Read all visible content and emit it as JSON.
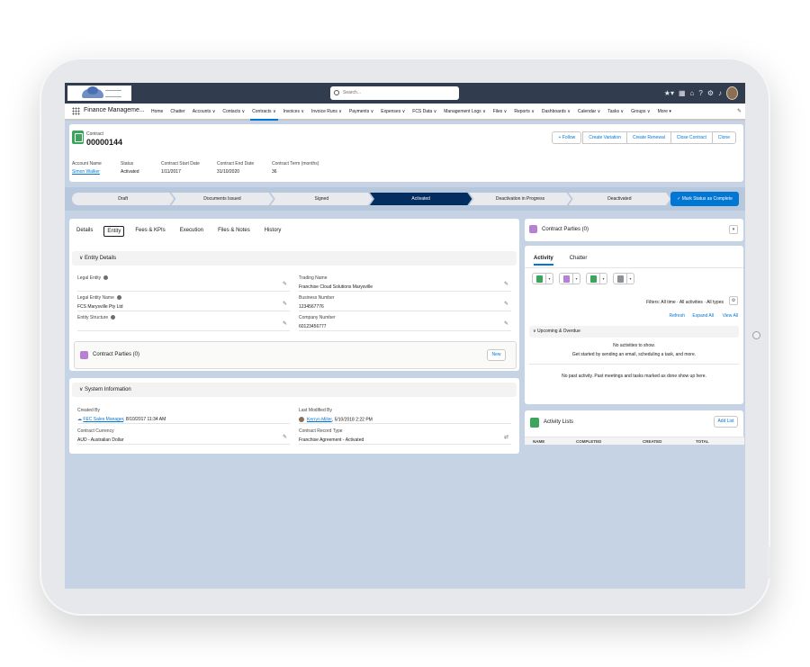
{
  "header": {
    "search_placeholder": "Search..."
  },
  "nav": {
    "app_name": "Finance Manageme...",
    "items": [
      {
        "label": "Home"
      },
      {
        "label": "Chatter"
      },
      {
        "label": "Accounts ∨"
      },
      {
        "label": "Contacts ∨"
      },
      {
        "label": "Contracts ∨"
      },
      {
        "label": "Invoices ∨"
      },
      {
        "label": "Invoice Runs ∨"
      },
      {
        "label": "Payments ∨"
      },
      {
        "label": "Expenses ∨"
      },
      {
        "label": "FCS Data ∨"
      },
      {
        "label": "Management Logs ∨"
      },
      {
        "label": "Files ∨"
      },
      {
        "label": "Reports ∨"
      },
      {
        "label": "Dashboards ∨"
      },
      {
        "label": "Calendar ∨"
      },
      {
        "label": "Tasks ∨"
      },
      {
        "label": "Groups ∨"
      },
      {
        "label": "More ▾"
      }
    ]
  },
  "record": {
    "type": "Contract",
    "number": "00000144",
    "buttons": {
      "follow": "+ Follow",
      "variation": "Create Variation",
      "renewal": "Create Renewal",
      "close": "Close Contract",
      "clone": "Clone"
    },
    "fields": [
      {
        "label": "Account Name",
        "value": "Simon Walker"
      },
      {
        "label": "Status",
        "value": "Activated"
      },
      {
        "label": "Contract Start Date",
        "value": "1/11/2017"
      },
      {
        "label": "Contract End Date",
        "value": "31/10/2020"
      },
      {
        "label": "Contract Term (months)",
        "value": "36"
      }
    ]
  },
  "path": {
    "stages": [
      {
        "label": "Draft"
      },
      {
        "label": "Documents Issued"
      },
      {
        "label": "Signed"
      },
      {
        "label": "Activated"
      },
      {
        "label": "Deactivation in Progress"
      },
      {
        "label": "Deactivated"
      }
    ],
    "mark_button": "✓ Mark Status as Complete"
  },
  "tabs": [
    {
      "label": "Details"
    },
    {
      "label": "Entity"
    },
    {
      "label": "Fees & KPIs"
    },
    {
      "label": "Execution"
    },
    {
      "label": "Files & Notes"
    },
    {
      "label": "History"
    }
  ],
  "entity": {
    "section_title": "∨  Entity Details",
    "legal_entity_label": "Legal Entity",
    "legal_entity_value": "",
    "trading_name_label": "Trading Name",
    "trading_name_value": "Franchise Cloud Solutions Marysville",
    "legal_entity_name_label": "Legal Entity Name",
    "legal_entity_name_value": "FCS Marysville Pty Ltd",
    "business_number_label": "Business Number",
    "business_number_value": "1234567776",
    "entity_structure_label": "Entity Structure",
    "entity_structure_value": "",
    "company_number_label": "Company Number",
    "company_number_value": "60123456777",
    "contract_parties_title": "Contract Parties (0)",
    "new_button": "New"
  },
  "system": {
    "section_title": "∨  System Information",
    "created_by_label": "Created By",
    "created_by_user": "FEC Sales Manager",
    "created_by_date": ", 8/10/2017 11:34 AM",
    "last_modified_label": "Last Modified By",
    "last_modified_user": "Kerryn Miller",
    "last_modified_date": ", 5/10/2018 2:22 PM",
    "currency_label": "Contract Currency",
    "currency_value": "AUD - Australian Dollar",
    "record_type_label": "Contract Record Type",
    "record_type_value": "Franchise Agreement - Activated"
  },
  "right": {
    "contract_parties_title": "Contract Parties (0)",
    "activity_tabs": [
      {
        "label": "Activity"
      },
      {
        "label": "Chatter"
      }
    ],
    "filters": "Filters: All time · All activities · All types",
    "refresh": "Refresh",
    "expand_all": "Expand All",
    "view_all": "View All",
    "upcoming": "∨  Upcoming & Overdue",
    "no_activities": "No activities to show.",
    "get_started": "Get started by sending an email, scheduling a task, and more.",
    "no_past": "No past activity. Past meetings and tasks marked as done show up here.",
    "activity_lists_title": "Activity Lists",
    "add_list": "Add List",
    "columns": [
      "NAME",
      "COMPLETED",
      "CREATED",
      "TOTAL"
    ]
  },
  "colors": {
    "header": "#313c4f",
    "brand_blue": "#0176d3",
    "active_stage": "#032d60",
    "record_icon": "#3ba55c",
    "parties_icon": "#b781d3"
  }
}
